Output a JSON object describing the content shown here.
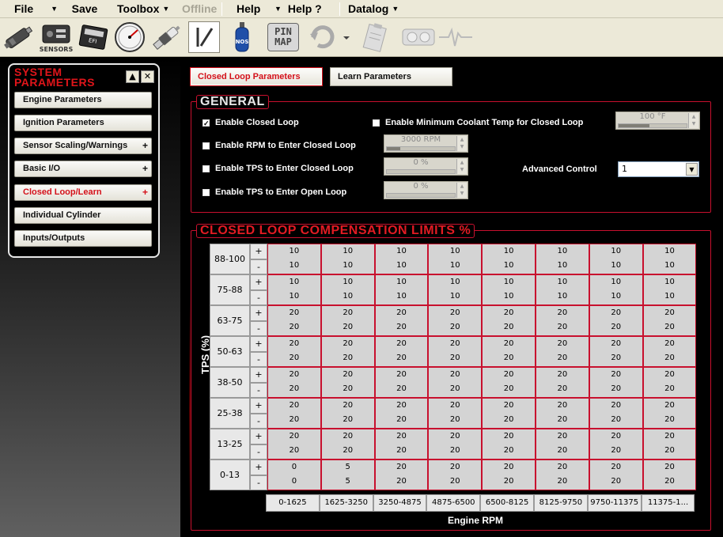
{
  "menubar": {
    "items": [
      {
        "label": "File",
        "disabled": false
      },
      {
        "label": "Save",
        "disabled": false
      },
      {
        "label": "Toolbox",
        "disabled": false
      },
      {
        "label": "Offline",
        "disabled": true
      },
      {
        "label": "Help",
        "disabled": false
      },
      {
        "label": "Help ?",
        "disabled": false
      },
      {
        "label": "Datalog",
        "disabled": false
      }
    ]
  },
  "toolbar": {
    "sensors_label": "SENSORS",
    "pinmap_line1": "PIN",
    "pinmap_line2": "MAP",
    "icons": [
      "injector-icon",
      "sensors-icon",
      "ecu-icon",
      "gauge-icon",
      "spark-plug-icon",
      "slash-icon",
      "nitrous-bottle-icon",
      "pin-map-icon",
      "refresh-icon",
      "clipboard-icon",
      "dashboard-gauges-icon",
      "waveform-icon"
    ]
  },
  "sidebar": {
    "title_line1": "SYSTEM",
    "title_line2": "PARAMETERS",
    "minimize": "▲",
    "close": "✕",
    "items": [
      {
        "label": "Engine Parameters",
        "plus": ""
      },
      {
        "label": "Ignition Parameters",
        "plus": ""
      },
      {
        "label": "Sensor Scaling/Warnings",
        "plus": "+"
      },
      {
        "label": "Basic I/O",
        "plus": "+"
      },
      {
        "label": "Closed Loop/Learn",
        "plus": "+",
        "active": true
      },
      {
        "label": "Individual Cylinder",
        "plus": ""
      },
      {
        "label": "Inputs/Outputs",
        "plus": ""
      }
    ]
  },
  "tabs": [
    {
      "label": "Closed Loop Parameters",
      "active": true
    },
    {
      "label": "Learn Parameters",
      "active": false
    }
  ],
  "general": {
    "title": "GENERAL",
    "enable_closed_loop": {
      "label": "Enable Closed Loop",
      "checked": true
    },
    "enable_rpm": {
      "label": "Enable RPM to Enter Closed Loop",
      "checked": false,
      "value": "3000 RPM",
      "fill": 0.2
    },
    "enable_tps_closed": {
      "label": "Enable TPS to Enter Closed Loop",
      "checked": false,
      "value": "0 %",
      "fill": 0
    },
    "enable_tps_open": {
      "label": "Enable TPS to Enter Open Loop",
      "checked": false,
      "value": "0 %",
      "fill": 0
    },
    "enable_coolant": {
      "label": "Enable Minimum Coolant Temp for Closed Loop",
      "checked": false,
      "value": "100 °F",
      "fill": 0.45
    },
    "advanced_control_label": "Advanced Control",
    "advanced_control_value": "1"
  },
  "limits": {
    "title": "CLOSED LOOP COMPENSATION LIMITS",
    "title_suffix": "%",
    "y_label": "TPS (%)",
    "x_label": "Engine RPM",
    "plus": "+",
    "minus": "-",
    "rpm": [
      "0-1625",
      "1625-3250",
      "3250-4875",
      "4875-6500",
      "6500-8125",
      "8125-9750",
      "9750-11375",
      "11375-1..."
    ],
    "rows": [
      {
        "tps": "88-100",
        "plus": [
          "10",
          "10",
          "10",
          "10",
          "10",
          "10",
          "10",
          "10"
        ],
        "minus": [
          "10",
          "10",
          "10",
          "10",
          "10",
          "10",
          "10",
          "10"
        ]
      },
      {
        "tps": "75-88",
        "plus": [
          "10",
          "10",
          "10",
          "10",
          "10",
          "10",
          "10",
          "10"
        ],
        "minus": [
          "10",
          "10",
          "10",
          "10",
          "10",
          "10",
          "10",
          "10"
        ]
      },
      {
        "tps": "63-75",
        "plus": [
          "20",
          "20",
          "20",
          "20",
          "20",
          "20",
          "20",
          "20"
        ],
        "minus": [
          "20",
          "20",
          "20",
          "20",
          "20",
          "20",
          "20",
          "20"
        ]
      },
      {
        "tps": "50-63",
        "plus": [
          "20",
          "20",
          "20",
          "20",
          "20",
          "20",
          "20",
          "20"
        ],
        "minus": [
          "20",
          "20",
          "20",
          "20",
          "20",
          "20",
          "20",
          "20"
        ]
      },
      {
        "tps": "38-50",
        "plus": [
          "20",
          "20",
          "20",
          "20",
          "20",
          "20",
          "20",
          "20"
        ],
        "minus": [
          "20",
          "20",
          "20",
          "20",
          "20",
          "20",
          "20",
          "20"
        ]
      },
      {
        "tps": "25-38",
        "plus": [
          "20",
          "20",
          "20",
          "20",
          "20",
          "20",
          "20",
          "20"
        ],
        "minus": [
          "20",
          "20",
          "20",
          "20",
          "20",
          "20",
          "20",
          "20"
        ]
      },
      {
        "tps": "13-25",
        "plus": [
          "20",
          "20",
          "20",
          "20",
          "20",
          "20",
          "20",
          "20"
        ],
        "minus": [
          "20",
          "20",
          "20",
          "20",
          "20",
          "20",
          "20",
          "20"
        ]
      },
      {
        "tps": "0-13",
        "plus": [
          "0",
          "5",
          "20",
          "20",
          "20",
          "20",
          "20",
          "20"
        ],
        "minus": [
          "0",
          "5",
          "20",
          "20",
          "20",
          "20",
          "20",
          "20"
        ]
      }
    ]
  },
  "colors": {
    "accent_red": "#c8102e",
    "title_red": "#e31b23",
    "panel_bg": "#000000",
    "chrome": "#ece9d8"
  }
}
